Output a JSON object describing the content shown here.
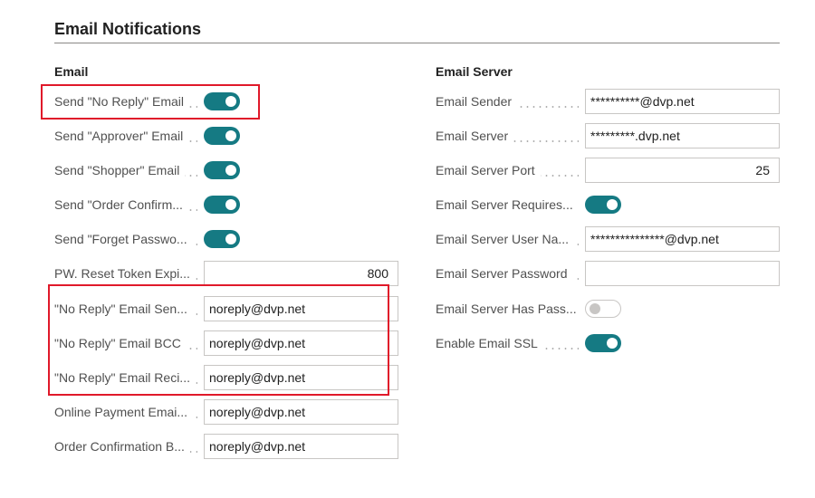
{
  "section": {
    "title": "Email Notifications"
  },
  "email": {
    "title": "Email",
    "rows": [
      {
        "label": "Send \"No Reply\" Email",
        "type": "toggle",
        "state": "on"
      },
      {
        "label": "Send \"Approver\" Email",
        "type": "toggle",
        "state": "on"
      },
      {
        "label": "Send \"Shopper\" Email",
        "type": "toggle",
        "state": "on"
      },
      {
        "label": "Send \"Order Confirm...",
        "type": "toggle",
        "state": "on"
      },
      {
        "label": "Send \"Forget Passwo...",
        "type": "toggle",
        "state": "on"
      },
      {
        "label": "PW. Reset Token Expi...",
        "type": "number",
        "value": "800"
      },
      {
        "label": "\"No Reply\" Email Sen...",
        "type": "text",
        "value": "noreply@dvp.net"
      },
      {
        "label": "\"No Reply\" Email BCC",
        "type": "text",
        "value": "noreply@dvp.net"
      },
      {
        "label": "\"No Reply\" Email Reci...",
        "type": "text",
        "value": "noreply@dvp.net"
      },
      {
        "label": "Online Payment Emai...",
        "type": "text",
        "value": "noreply@dvp.net"
      },
      {
        "label": "Order Confirmation B...",
        "type": "text",
        "value": "noreply@dvp.net"
      }
    ]
  },
  "server": {
    "title": "Email Server",
    "rows": [
      {
        "label": "Email Sender",
        "type": "text",
        "value": "**********@dvp.net"
      },
      {
        "label": "Email Server",
        "type": "text",
        "value": "*********.dvp.net"
      },
      {
        "label": "Email Server Port",
        "type": "number",
        "value": "25"
      },
      {
        "label": "Email Server Requires...",
        "type": "toggle",
        "state": "on"
      },
      {
        "label": "Email Server User Na...",
        "type": "text",
        "value": "***************@dvp.net"
      },
      {
        "label": "Email Server Password",
        "type": "text",
        "value": ""
      },
      {
        "label": "Email Server Has Pass...",
        "type": "toggle",
        "state": "off"
      },
      {
        "label": "Enable Email SSL",
        "type": "toggle",
        "state": "on"
      }
    ]
  },
  "colors": {
    "accent": "#157a83",
    "highlight": "#e0192a"
  }
}
